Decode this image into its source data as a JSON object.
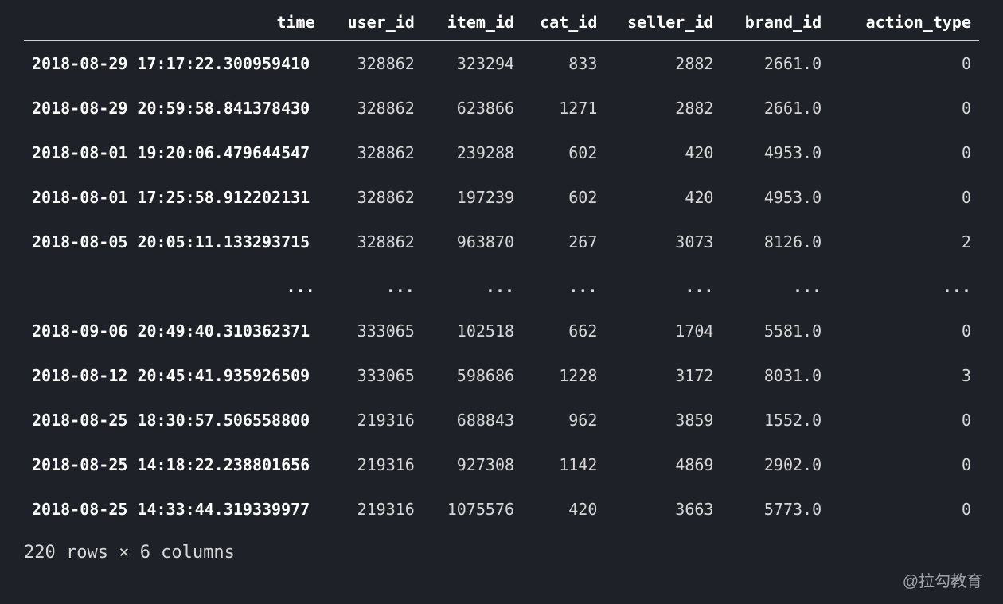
{
  "table": {
    "index_name": "time",
    "columns": [
      "user_id",
      "item_id",
      "cat_id",
      "seller_id",
      "brand_id",
      "action_type"
    ],
    "rows_head": [
      {
        "index": "2018-08-29 17:17:22.300959410",
        "cells": [
          "328862",
          "323294",
          "833",
          "2882",
          "2661.0",
          "0"
        ]
      },
      {
        "index": "2018-08-29 20:59:58.841378430",
        "cells": [
          "328862",
          "623866",
          "1271",
          "2882",
          "2661.0",
          "0"
        ]
      },
      {
        "index": "2018-08-01 19:20:06.479644547",
        "cells": [
          "328862",
          "239288",
          "602",
          "420",
          "4953.0",
          "0"
        ]
      },
      {
        "index": "2018-08-01 17:25:58.912202131",
        "cells": [
          "328862",
          "197239",
          "602",
          "420",
          "4953.0",
          "0"
        ]
      },
      {
        "index": "2018-08-05 20:05:11.133293715",
        "cells": [
          "328862",
          "963870",
          "267",
          "3073",
          "8126.0",
          "2"
        ]
      }
    ],
    "ellipsis": "...",
    "rows_tail": [
      {
        "index": "2018-09-06 20:49:40.310362371",
        "cells": [
          "333065",
          "102518",
          "662",
          "1704",
          "5581.0",
          "0"
        ]
      },
      {
        "index": "2018-08-12 20:45:41.935926509",
        "cells": [
          "333065",
          "598686",
          "1228",
          "3172",
          "8031.0",
          "3"
        ]
      },
      {
        "index": "2018-08-25 18:30:57.506558800",
        "cells": [
          "219316",
          "688843",
          "962",
          "3859",
          "1552.0",
          "0"
        ]
      },
      {
        "index": "2018-08-25 14:18:22.238801656",
        "cells": [
          "219316",
          "927308",
          "1142",
          "4869",
          "2902.0",
          "0"
        ]
      },
      {
        "index": "2018-08-25 14:33:44.319339977",
        "cells": [
          "219316",
          "1075576",
          "420",
          "3663",
          "5773.0",
          "0"
        ]
      }
    ],
    "shape_text": "220 rows × 6 columns"
  },
  "watermark": "@拉勾教育"
}
